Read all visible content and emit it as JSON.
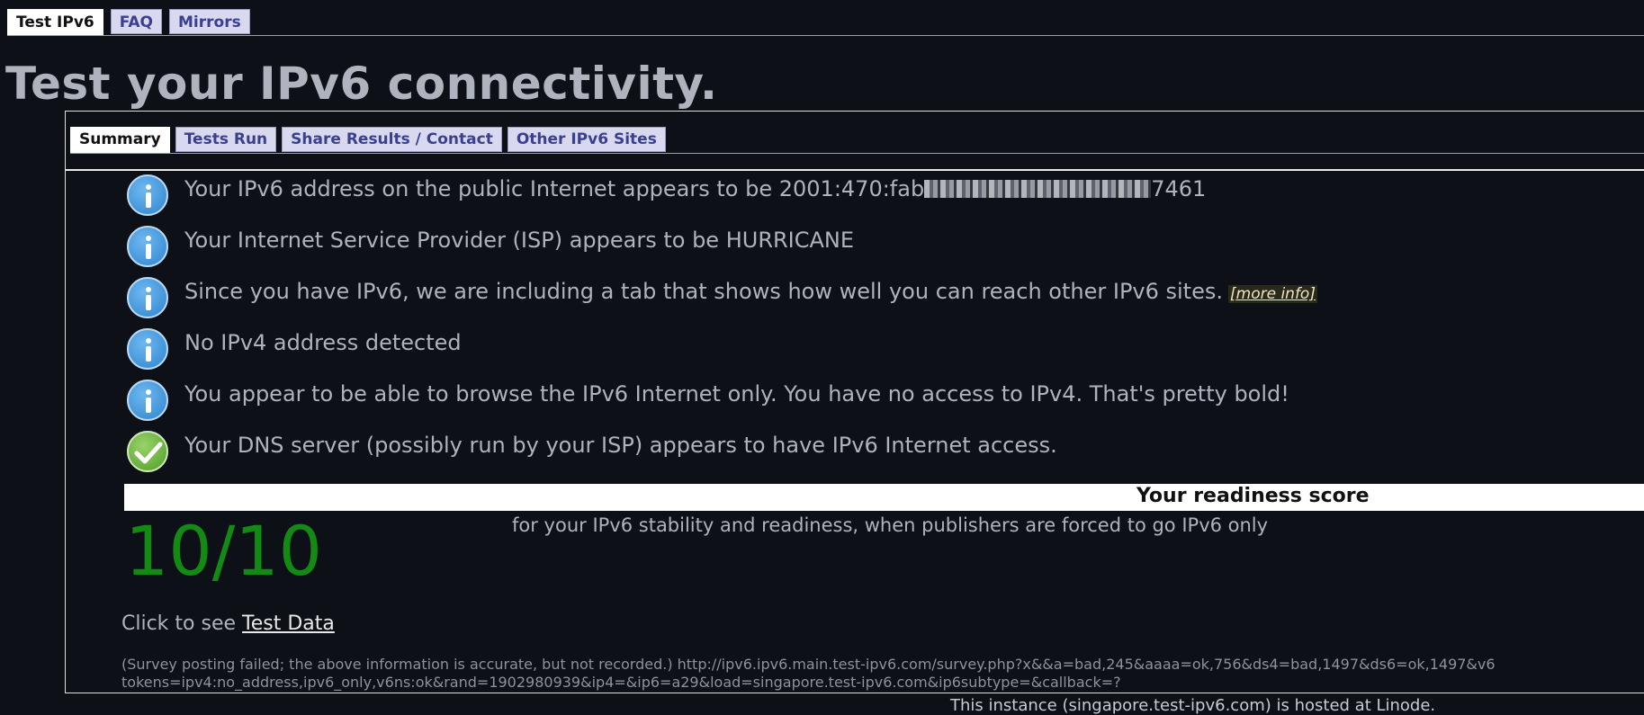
{
  "top_tabs": [
    {
      "label": "Test IPv6",
      "active": true
    },
    {
      "label": "FAQ",
      "active": false
    },
    {
      "label": "Mirrors",
      "active": false
    }
  ],
  "page_title": "Test your IPv6 connectivity.",
  "inner_tabs": [
    {
      "label": "Summary",
      "active": true
    },
    {
      "label": "Tests Run",
      "active": false
    },
    {
      "label": "Share Results / Contact",
      "active": false
    },
    {
      "label": "Other IPv6 Sites",
      "active": false
    }
  ],
  "messages": [
    {
      "icon": "info-icon",
      "text_prefix": "Your IPv6 address on the public Internet appears to be 2001:470:fab",
      "text_suffix": "7461",
      "redacted": true
    },
    {
      "icon": "info-icon",
      "text": "Your Internet Service Provider (ISP) appears to be HURRICANE"
    },
    {
      "icon": "info-icon",
      "text": "Since you have IPv6, we are including a tab that shows how well you can reach other IPv6 sites.",
      "link": "[more info]"
    },
    {
      "icon": "info-icon",
      "text": "No IPv4 address detected"
    },
    {
      "icon": "info-icon",
      "text": "You appear to be able to browse the IPv6 Internet only. You have no access to IPv4. That's pretty bold!"
    },
    {
      "icon": "check-icon",
      "text": "Your DNS server (possibly run by your ISP) appears to have IPv6 Internet access."
    }
  ],
  "score": {
    "heading": "Your readiness score",
    "subtitle": "for your IPv6 stability and readiness, when publishers are forced to go IPv6 only",
    "value": "10/10",
    "color": "#138a13"
  },
  "test_data": {
    "prefix": "Click to see ",
    "link": "Test Data"
  },
  "survey": {
    "line1": "(Survey posting failed; the above information is accurate, but not recorded.) http://ipv6.ipv6.main.test-ipv6.com/survey.php?x&&a=bad,245&aaaa=ok,756&ds4=bad,1497&ds6=ok,1497&v6",
    "line2": "tokens=ipv4:no_address,ipv6_only,v6ns:ok&rand=1902980939&ip4=&ip6=a29&load=singapore.test-ipv6.com&ip6subtype=&callback=?"
  },
  "footer": "This instance (singapore.test-ipv6.com) is hosted at Linode."
}
